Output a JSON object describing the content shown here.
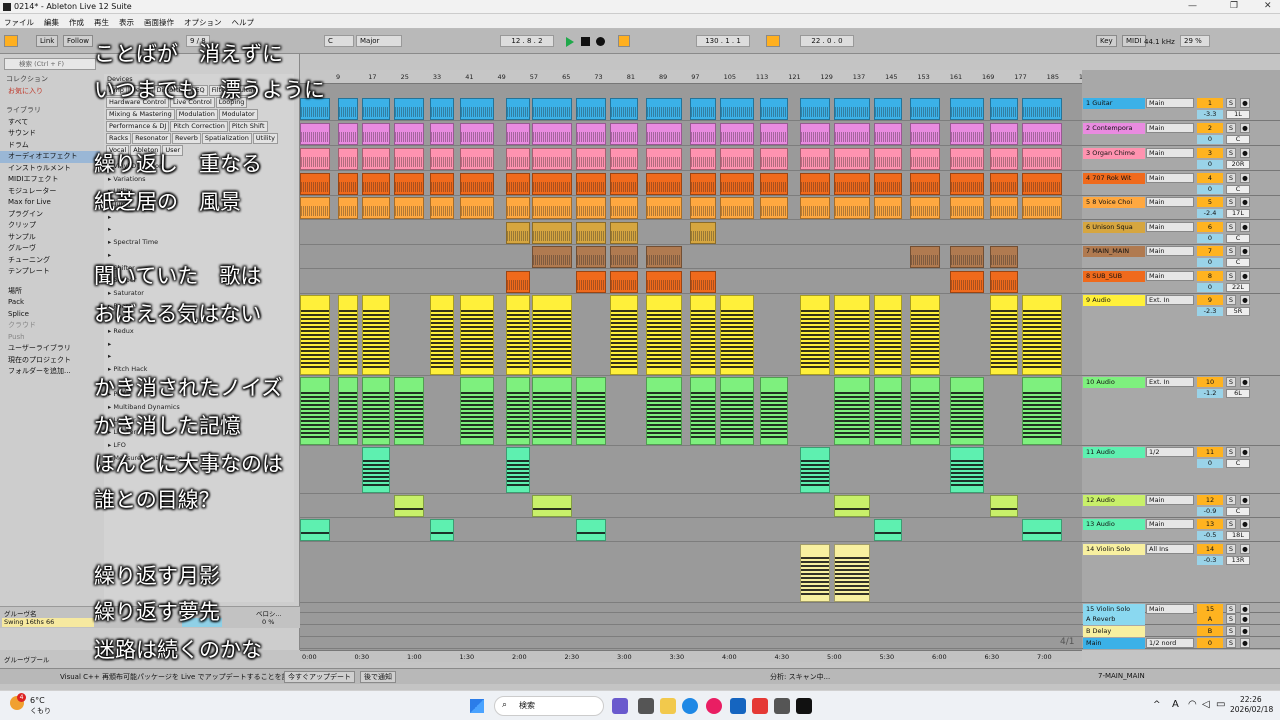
{
  "window": {
    "title": "0214* - Ableton Live 12 Suite",
    "minimize": "—",
    "maximize": "❐",
    "close": "✕"
  },
  "menu": [
    "ファイル",
    "編集",
    "作成",
    "再生",
    "表示",
    "画面操作",
    "オプション",
    "ヘルプ"
  ],
  "transport": {
    "link": "Link",
    "follow": "Follow",
    "tempo_sig": "9 / 8",
    "key": "C",
    "scale": "Major",
    "position": "12 . 8 . 2",
    "loop_start": "130 . 1 . 1",
    "loop_len": "22 . 0 . 0",
    "key_label": "Key",
    "midi_label": "MIDI",
    "sample_rate": "44.1 kHz",
    "cpu": "29 %"
  },
  "browser": {
    "search": "検索 (Ctrl + F)",
    "collection_header": "コレクション",
    "favorites": "お気に入り",
    "library_header": "ライブラリ",
    "library": [
      "すべて",
      "サウンド",
      "ドラム",
      "オーディオエフェクト",
      "インストゥルメント",
      "MIDIエフェクト",
      "モジュレーター",
      "Max for Live",
      "プラグイン",
      "クリップ",
      "サンプル",
      "グルーヴ",
      "チューニング",
      "テンプレート"
    ],
    "places": [
      "場所",
      "Pack",
      "Splice",
      "クラウド",
      "Push",
      "ユーザーライブラリ",
      "現在のプロジェクト",
      "フォルダーを追加..."
    ],
    "devices_header": "Devices",
    "chips": [
      "Amp",
      "Delay",
      "Distortion",
      "EQ",
      "Filter",
      "Guitar",
      "Hardware Control",
      "Live Control",
      "Looping",
      "Mixing & Mastering",
      "Modulation",
      "Modulator",
      "Performance & DJ",
      "Pitch Correction",
      "Pitch Shift",
      "Racks",
      "Resonator",
      "Reverb",
      "Spatialization",
      "Utility",
      "Vocal",
      "Ableton",
      "User"
    ],
    "tree": [
      "Vinyl Distortion",
      "Variations",
      "Utility",
      "Tuner",
      "",
      "",
      "Spectral Time",
      "",
      "Shifter",
      "Shaper",
      "Saturator",
      "Roar",
      "",
      "Redux",
      "",
      "",
      "Pitch Hack",
      "",
      "Pedal",
      "Multiband Dynamics",
      "Looper",
      "Limiter",
      "LFO",
      "Measurement Device"
    ]
  },
  "groove": {
    "header": "グルーヴ名",
    "col2": "ベロシ...",
    "name": "Swing 16ths 66",
    "val": "0 %",
    "pool": "グルーヴプール"
  },
  "ruler": [
    "9",
    "17",
    "25",
    "33",
    "41",
    "49",
    "57",
    "65",
    "73",
    "81",
    "89",
    "97",
    "105",
    "113",
    "121",
    "129",
    "137",
    "145",
    "153",
    "161",
    "169",
    "177",
    "185",
    "193"
  ],
  "time": [
    "0:00",
    "0:30",
    "1:00",
    "1:30",
    "2:00",
    "2:30",
    "3:00",
    "3:30",
    "4:00",
    "4:30",
    "5:00",
    "5:30",
    "6:00",
    "6:30",
    "7:00"
  ],
  "zoom": "4/1",
  "tracks": [
    {
      "name": "1 Guitar",
      "color": "#3bb1e8",
      "io": "Main",
      "num": "1",
      "vol": "-3.3",
      "pan": "1L"
    },
    {
      "name": "2 Contempora",
      "color": "#e98be0",
      "io": "Main",
      "num": "2",
      "vol": "0",
      "pan": "C"
    },
    {
      "name": "3 Organ Chime",
      "color": "#ff93b0",
      "io": "Main",
      "num": "3",
      "vol": "0",
      "pan": "20R"
    },
    {
      "name": "4 707 Rok Wit",
      "color": "#f06a1c",
      "io": "Main",
      "num": "4",
      "vol": "0",
      "pan": "C"
    },
    {
      "name": "5 8 Voice Choi",
      "color": "#ffa840",
      "io": "Main",
      "num": "5",
      "vol": "-2.4",
      "pan": "17L"
    },
    {
      "name": "6 Unison Squa",
      "color": "#d6a640",
      "io": "Main",
      "num": "6",
      "vol": "0",
      "pan": "C"
    },
    {
      "name": "7 MAIN_MAIN",
      "color": "#b07a50",
      "io": "Main",
      "num": "7",
      "vol": "0",
      "pan": "C"
    },
    {
      "name": "8 SUB_SUB",
      "color": "#f06a1c",
      "io": "Main",
      "num": "8",
      "vol": "0",
      "pan": "22L"
    },
    {
      "name": "9 Audio",
      "color": "#fff03a",
      "io": "Ext. In",
      "num": "9",
      "vol": "-2.3",
      "pan": "5R"
    },
    {
      "name": "10 Audio",
      "color": "#7ef07e",
      "io": "Ext. In",
      "num": "10",
      "vol": "-1.2",
      "pan": "6L"
    },
    {
      "name": "11 Audio",
      "color": "#5ef0b0",
      "io": "1/2",
      "num": "11",
      "vol": "0",
      "pan": "C"
    },
    {
      "name": "12 Audio",
      "color": "#c8f06a",
      "io": "Main",
      "num": "12",
      "vol": "-0.9",
      "pan": "C"
    },
    {
      "name": "13 Audio",
      "color": "#5ef0b0",
      "io": "Main",
      "num": "13",
      "vol": "-0.5",
      "pan": "18L"
    },
    {
      "name": "14 Violin Solo",
      "color": "#f8f0a0",
      "io": "All Ins",
      "num": "14",
      "vol": "-0.3",
      "pan": "13R"
    },
    {
      "name": "15 Violin Solo",
      "color": "#8ad8f0",
      "io": "Main",
      "num": "15",
      "vol": "0",
      "pan": "C"
    },
    {
      "name": "A Reverb",
      "color": "#8ad8f0",
      "io": "",
      "num": "A",
      "vol": "",
      "pan": ""
    },
    {
      "name": "B Delay",
      "color": "#f8f0a0",
      "io": "",
      "num": "B",
      "vol": "",
      "pan": ""
    },
    {
      "name": "Main",
      "color": "#3bb1e8",
      "io": "1/2 nord",
      "num": "0",
      "vol": "",
      "pan": ""
    }
  ],
  "lyrics": [
    "ことばが　消えずに",
    "いつまでも　漂うように",
    "繰り返し　重なる",
    "紙芝居の　風景",
    "聞いていた　歌は",
    "おぼえる気はない",
    "かき消されたノイズ",
    "かき消した記憶",
    "ほんとに大事なのは",
    "誰との目線？",
    "繰り返す月影",
    "繰り返す夢先",
    "迷路は続くのかな"
  ],
  "status": {
    "message": "Visual C++ 再頒布可能パッケージを Live でアップデートすることを許可します。",
    "update_now": "今すぐアップデート",
    "no_notice": "後で通知",
    "analysis": "分析: スキャン中...",
    "track_sel": "7-MAIN_MAIN"
  },
  "taskbar": {
    "temp": "6°C",
    "weather": "くもり",
    "search": "検索",
    "time": "22:26",
    "date": "2026/02/18",
    "badge": "4",
    "lang": "A"
  }
}
